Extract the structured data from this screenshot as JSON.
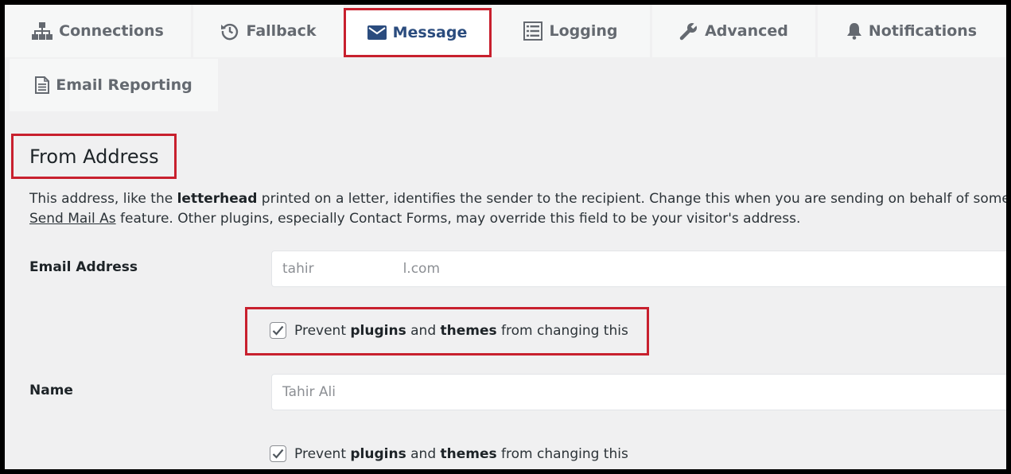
{
  "tabs": [
    {
      "label": "Connections",
      "icon": "sitemap-icon"
    },
    {
      "label": "Fallback",
      "icon": "history-icon"
    },
    {
      "label": "Message",
      "icon": "envelope-icon",
      "active": true
    },
    {
      "label": "Logging",
      "icon": "list-icon"
    },
    {
      "label": "Advanced",
      "icon": "wrench-icon"
    },
    {
      "label": "Notifications",
      "icon": "bell-icon"
    },
    {
      "label": "Email Reporting",
      "icon": "document-icon"
    }
  ],
  "section": {
    "title": "From Address",
    "description": {
      "part1": "This address, like the ",
      "bold": "letterhead",
      "part2": " printed on a letter, identifies the sender to the recipient. Change this when you are sending on behalf of some",
      "link": "Send Mail As",
      "part3": " feature. Other plugins, especially Contact Forms, may override this field to be your visitor's address."
    }
  },
  "fields": {
    "email": {
      "label": "Email Address",
      "value_start": "tahir",
      "value_end": "l.com"
    },
    "email_prevent": {
      "checked": true,
      "text1": "Prevent ",
      "bold1": "plugins",
      "text2": " and ",
      "bold2": "themes",
      "text3": " from changing this"
    },
    "name": {
      "label": "Name",
      "value": "Tahir Ali"
    },
    "name_prevent": {
      "checked": true,
      "text1": "Prevent ",
      "bold1": "plugins",
      "text2": " and ",
      "bold2": "themes",
      "text3": " from changing this"
    }
  },
  "colors": {
    "highlight": "#c8202e",
    "active_tab": "#2b4c7e",
    "inactive_tab": "#646970"
  }
}
